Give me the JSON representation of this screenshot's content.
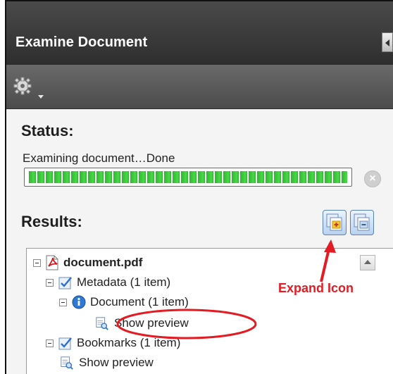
{
  "panel": {
    "title": "Examine Document",
    "icons": {
      "collapse": "collapse-panel-icon",
      "options": "gear-icon"
    }
  },
  "status": {
    "heading": "Status:",
    "message": "Examining document…Done",
    "progress": 1.0,
    "progress_color": "#2fb52f"
  },
  "results": {
    "heading": "Results:",
    "buttons": [
      {
        "icon": "expand-all-icon"
      },
      {
        "icon": "collapse-all-icon"
      }
    ],
    "tree": [
      {
        "label": "document.pdf",
        "icon": "pdf-icon"
      },
      {
        "label": "Metadata (1 item)",
        "icon": "checkbox-checked-icon"
      },
      {
        "label": "Document (1 item)",
        "icon": "info-icon"
      },
      {
        "label": "Show preview",
        "icon": "preview-icon"
      },
      {
        "label": "Bookmarks (1 item)",
        "icon": "checkbox-checked-icon"
      },
      {
        "label": "Show preview",
        "icon": "preview-icon"
      }
    ]
  },
  "annotation": {
    "label": "Expand Icon",
    "color": "#e31b23"
  }
}
